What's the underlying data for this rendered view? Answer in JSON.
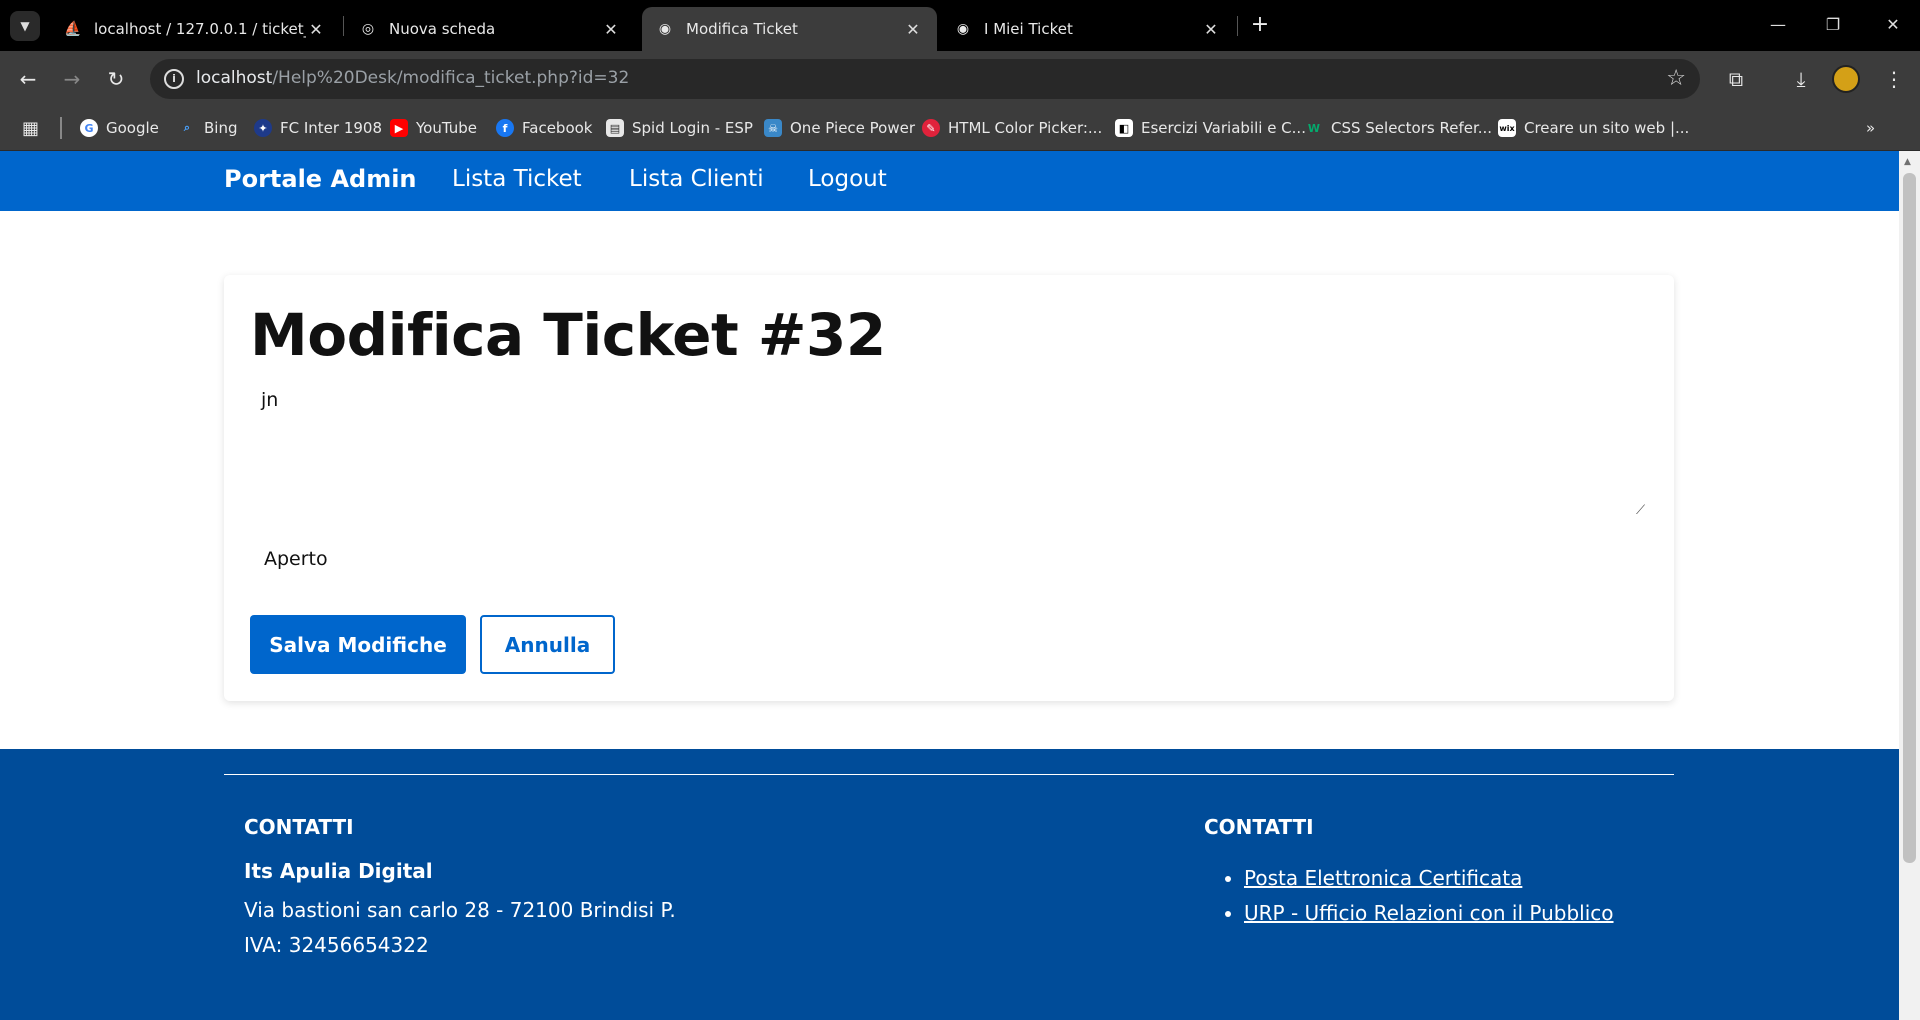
{
  "browser": {
    "tabs": [
      {
        "title": "localhost / 127.0.0.1 / ticket_ma",
        "icon": "phpmyadmin-icon",
        "active": false
      },
      {
        "title": "Nuova scheda",
        "icon": "chrome-icon",
        "active": false
      },
      {
        "title": "Modifica Ticket",
        "icon": "globe-icon",
        "active": true
      },
      {
        "title": "I Miei Ticket",
        "icon": "globe-icon",
        "active": false
      }
    ],
    "url_host": "localhost",
    "url_path": "/Help%20Desk/modifica_ticket.php?id=32",
    "bookmarks": [
      {
        "label": "Google",
        "icon": "google-icon"
      },
      {
        "label": "Bing",
        "icon": "bing-icon"
      },
      {
        "label": "FC Inter 1908",
        "icon": "inter-icon"
      },
      {
        "label": "YouTube",
        "icon": "youtube-icon"
      },
      {
        "label": "Facebook",
        "icon": "facebook-icon"
      },
      {
        "label": "Spid Login - ESP",
        "icon": "document-icon"
      },
      {
        "label": "One Piece Power",
        "icon": "onepiece-icon"
      },
      {
        "label": "HTML Color Picker:...",
        "icon": "color-picker-icon"
      },
      {
        "label": "Esercizi Variabili e C...",
        "icon": "exercise-icon"
      },
      {
        "label": "CSS Selectors Refer...",
        "icon": "w3schools-icon"
      },
      {
        "label": "Creare un sito web |...",
        "icon": "wix-icon"
      }
    ]
  },
  "site_nav": {
    "brand": "Portale Admin",
    "links": [
      "Lista Ticket",
      "Lista Clienti",
      "Logout"
    ]
  },
  "form": {
    "title": "Modifica Ticket #32",
    "description": "jn",
    "status": "Aperto",
    "save_label": "Salva Modifiche",
    "cancel_label": "Annulla"
  },
  "footer": {
    "left_heading": "CONTATTI",
    "org": "Its Apulia Digital",
    "address": "Via bastioni san carlo 28 - 72100 Brindisi P. IVA: 32456654322",
    "right_heading": "CONTATTI",
    "links": [
      "Posta Elettronica Certificata",
      "URP - Ufficio Relazioni con il Pubblico"
    ]
  },
  "colors": {
    "primary": "#0066cc",
    "footer": "#004c99"
  }
}
